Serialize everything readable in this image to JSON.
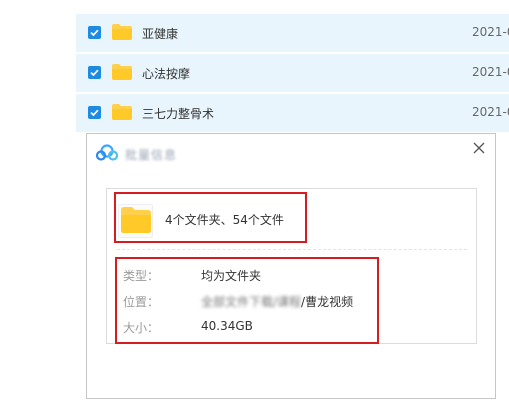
{
  "files": [
    {
      "name": "亚健康",
      "date": "2021-0",
      "checked": true
    },
    {
      "name": "心法按摩",
      "date": "2021-0",
      "checked": true
    },
    {
      "name": "三七力整骨术",
      "date": "2021-0",
      "checked": true
    }
  ],
  "dialog": {
    "title": "批量信息",
    "summary": "4个文件夹、54个文件",
    "type_label": "类型：",
    "type_value": "均为文件夹",
    "location_label": "位置：",
    "location_blur": "全部文件下载/课程",
    "location_suffix": "/曹龙视频",
    "size_label": "大小：",
    "size_value": "40.34GB"
  },
  "colors": {
    "row_bg": "#e9f5fd",
    "checkbox": "#1e8ae0",
    "folder": "#ffd04c",
    "highlight": "#d51c21"
  }
}
